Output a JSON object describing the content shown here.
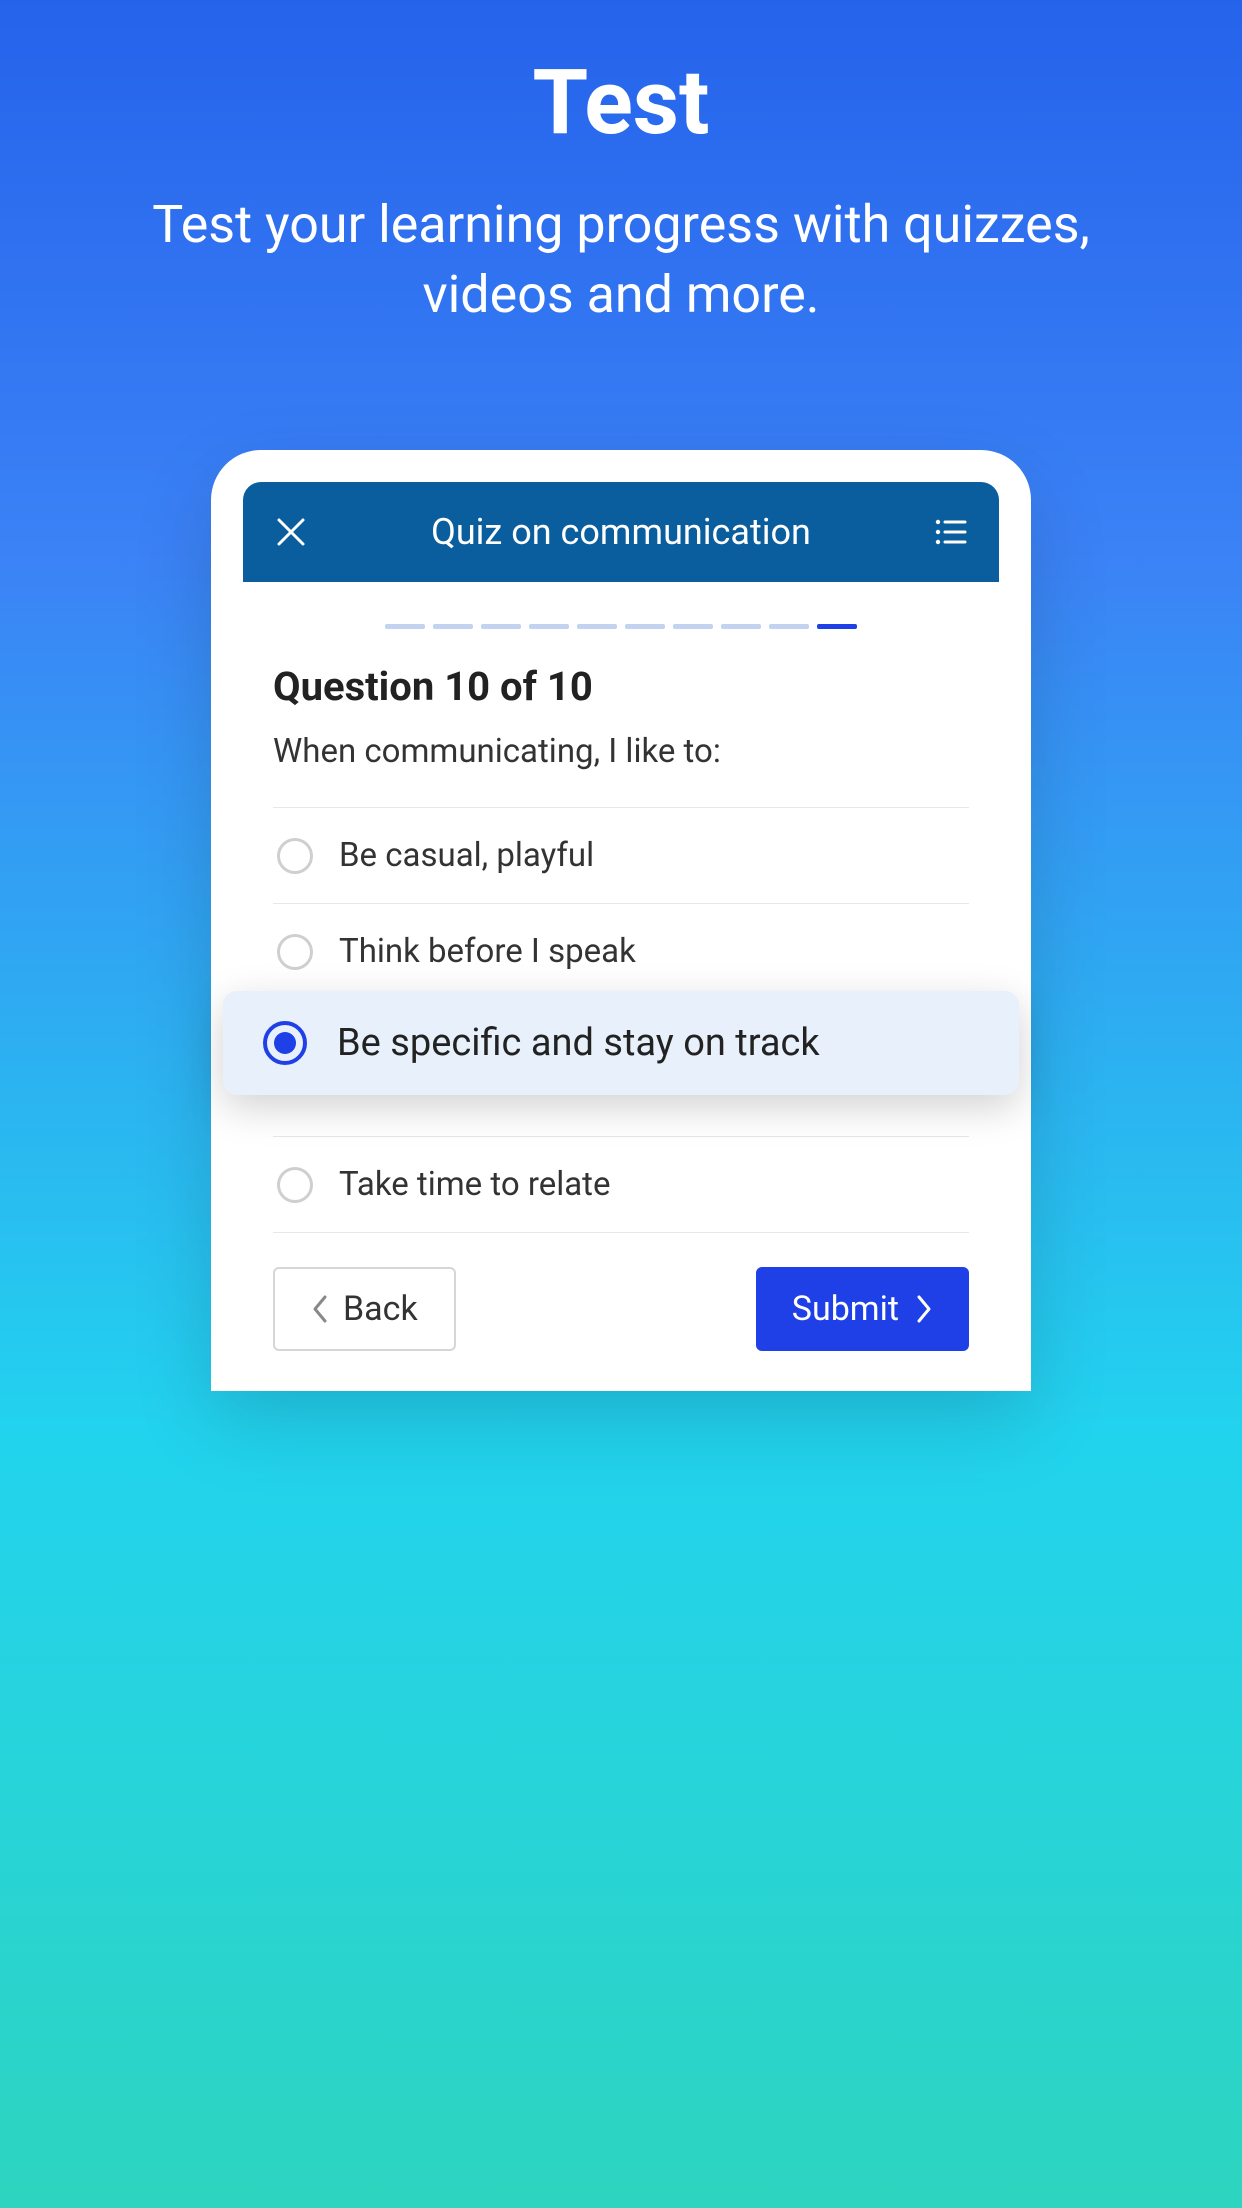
{
  "hero": {
    "title": "Test",
    "subtitle": "Test your learning progress with quizzes, videos and more."
  },
  "app": {
    "header_title": "Quiz on communication",
    "progress": {
      "total": 10,
      "current": 10
    },
    "question_label": "Question 10 of 10",
    "question_text": "When communicating, I like to:",
    "options": [
      {
        "label": "Be casual, playful",
        "selected": false
      },
      {
        "label": "Think before I speak",
        "selected": false
      },
      {
        "label": "Be specific and stay on track",
        "selected": true
      },
      {
        "label": "Take time to relate",
        "selected": false
      }
    ],
    "back_label": "Back",
    "submit_label": "Submit"
  },
  "colors": {
    "accent": "#1e40e6",
    "header_bg": "#0b5e9e"
  }
}
